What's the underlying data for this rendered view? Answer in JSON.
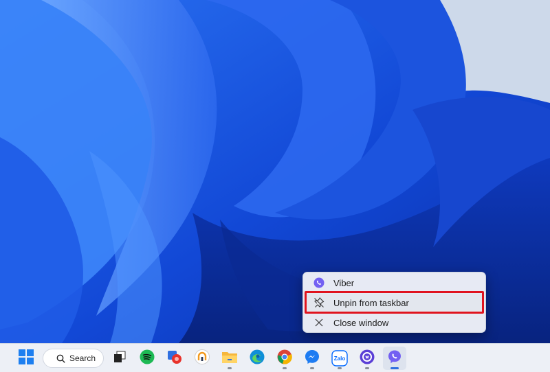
{
  "context_menu": {
    "items": [
      {
        "label": "Viber",
        "icon": "viber-icon"
      },
      {
        "label": "Unpin from taskbar",
        "icon": "unpin-icon"
      },
      {
        "label": "Close window",
        "icon": "close-icon"
      }
    ]
  },
  "taskbar": {
    "search_label": "Search",
    "apps": [
      {
        "name": "start-icon"
      },
      {
        "name": "task-view-icon"
      },
      {
        "name": "spotify-icon"
      },
      {
        "name": "screenshot-tool-icon"
      },
      {
        "name": "vpn-app-icon"
      },
      {
        "name": "file-explorer-icon"
      },
      {
        "name": "edge-icon"
      },
      {
        "name": "chrome-icon"
      },
      {
        "name": "messenger-icon"
      },
      {
        "name": "zalo-icon",
        "text": "Zalo"
      },
      {
        "name": "chat-app-icon"
      },
      {
        "name": "viber-icon"
      }
    ]
  },
  "colors": {
    "highlight": "#e0141f",
    "wallpaper": "#1a4fd8",
    "viber": "#7360f2"
  }
}
